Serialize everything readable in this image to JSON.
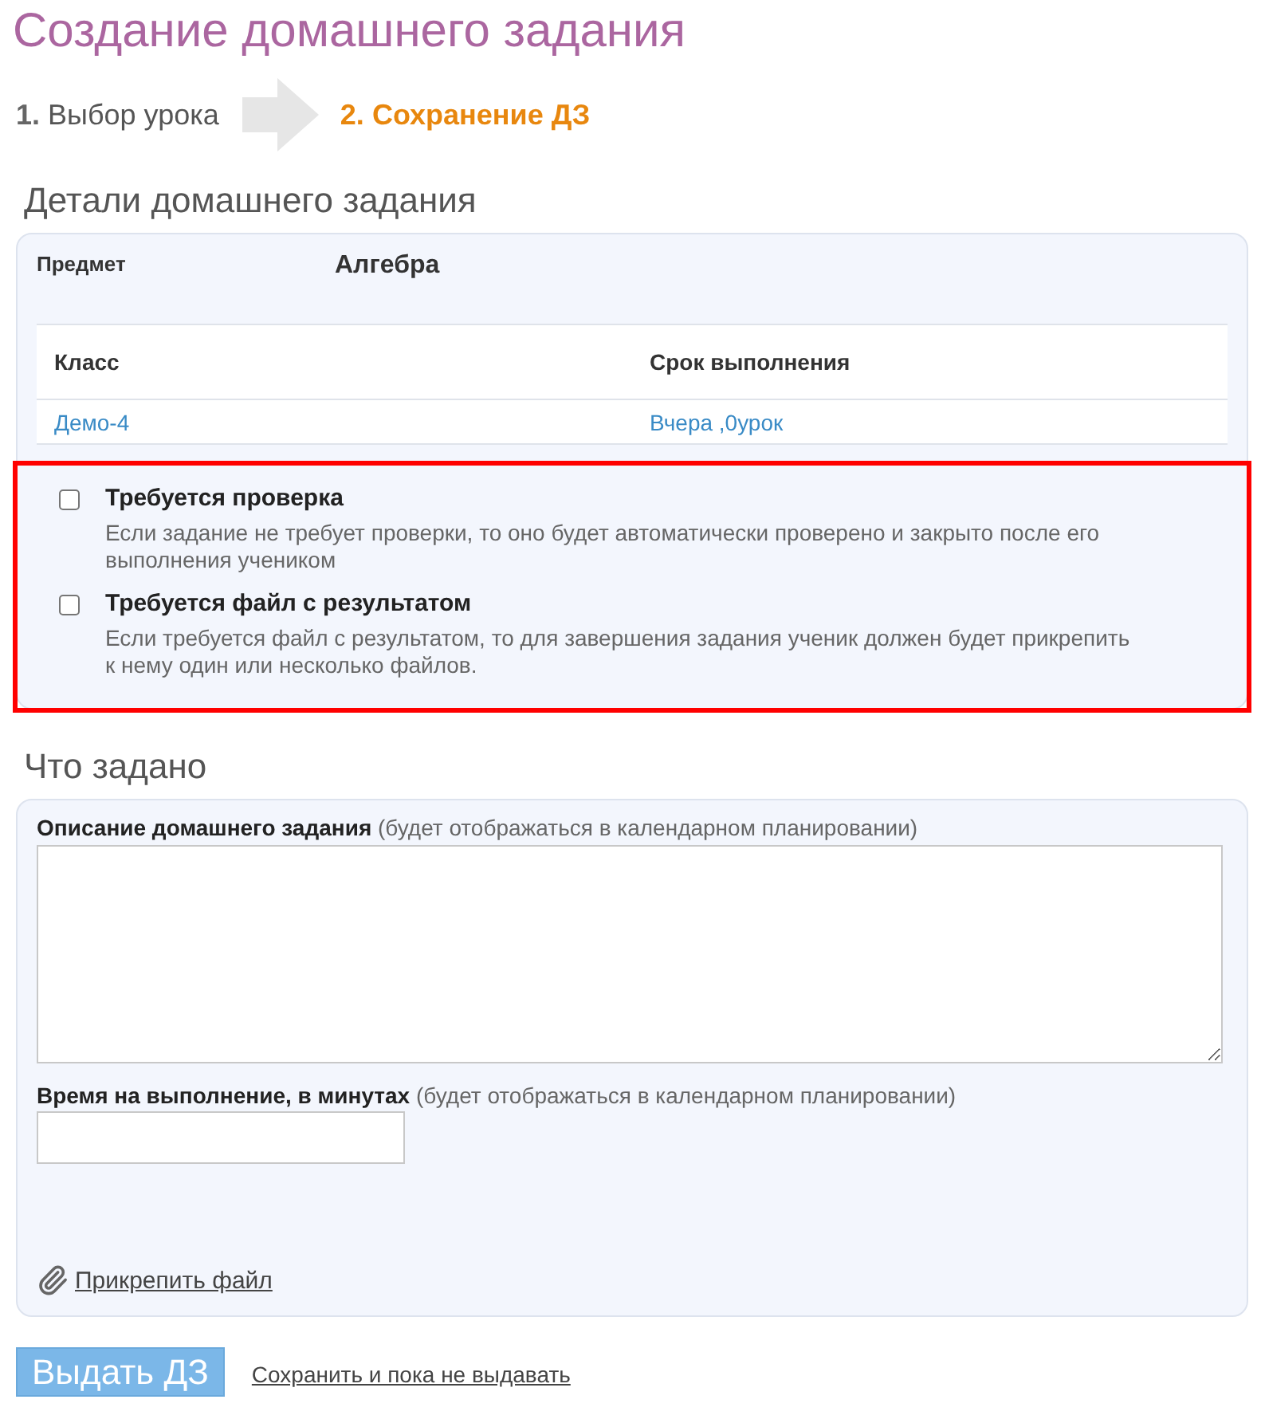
{
  "page": {
    "title": "Создание домашнего задания"
  },
  "steps": [
    {
      "number": "1.",
      "label": "Выбор урока",
      "selected": false
    },
    {
      "number": "2.",
      "label": "Сохранение ДЗ",
      "selected": true
    }
  ],
  "details": {
    "heading": "Детали домашнего задания",
    "subject_label": "Предмет",
    "subject_value": "Алгебра",
    "table": {
      "columns": [
        "Класс",
        "Срок выполнения"
      ],
      "rows": [
        [
          "Демо-4",
          "Вчера ,0урок"
        ]
      ]
    }
  },
  "options": {
    "highlighted": true,
    "items": [
      {
        "label": "Требуется проверка",
        "description": "Если задание не требует проверки, то оно будет автоматически проверено и закрыто после его выполнения учеником",
        "checked": false
      },
      {
        "label": "Требуется файл с результатом",
        "description": "Если требуется файл с результатом, то для завершения задания ученик должен будет прикрепить к нему один или несколько файлов.",
        "checked": false
      }
    ]
  },
  "assignment": {
    "heading": "Что задано",
    "description_field": {
      "label": "Описание домашнего задания",
      "hint": "(будет отображаться в календарном планировании)"
    },
    "time_field": {
      "label": "Время на выполнение, в минутах",
      "hint": "(будет отображаться в календарном планировании)"
    },
    "attach_link": "Прикрепить файл"
  },
  "actions": {
    "primary": "Выдать ДЗ",
    "secondary": "Сохранить и пока не выдавать"
  }
}
